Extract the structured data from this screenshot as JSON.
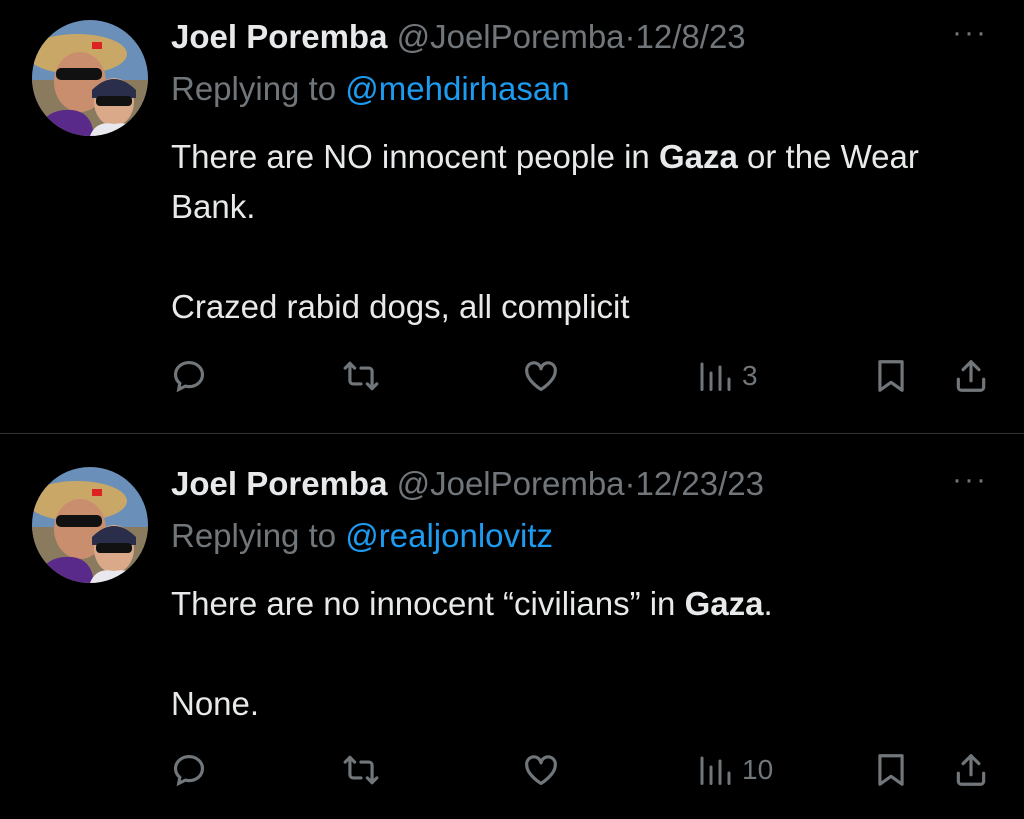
{
  "tweets": [
    {
      "name": "Joel Poremba",
      "handle": "@JoelPoremba",
      "separator": "·",
      "date": "12/8/23",
      "more": "···",
      "replying_prefix": "Replying to ",
      "replying_to": "@mehdirhasan",
      "line1_before": "There are NO innocent people in ",
      "line1_bold": "Gaza",
      "line1_after": " or the Wear Bank.",
      "line2": "Crazed rabid dogs, all complicit",
      "views": "3"
    },
    {
      "name": "Joel Poremba",
      "handle": "@JoelPoremba",
      "separator": "·",
      "date": "12/23/23",
      "more": "···",
      "replying_prefix": "Replying to ",
      "replying_to": "@realjonlovitz",
      "line1_before": "There are no innocent “civilians” in ",
      "line1_bold": "Gaza",
      "line1_after": ".",
      "line2": "None.",
      "views": "10"
    }
  ],
  "icons": {
    "reply": "reply-icon",
    "retweet": "retweet-icon",
    "like": "heart-icon",
    "views": "views-icon",
    "bookmark": "bookmark-icon",
    "share": "share-icon"
  },
  "colors": {
    "background": "#000000",
    "text": "#e7e9ea",
    "muted": "#71767b",
    "mention": "#1d9bf0",
    "divider": "#2f3336"
  }
}
